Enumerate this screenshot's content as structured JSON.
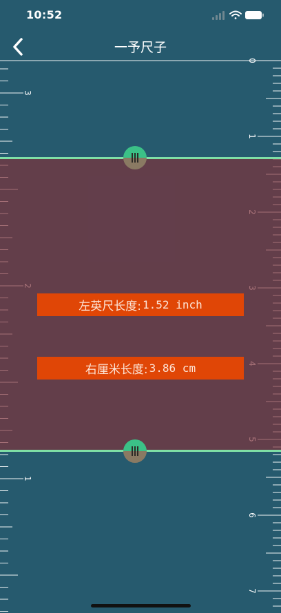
{
  "status_bar": {
    "time": "10:52",
    "icons": [
      "cellular-icon",
      "wifi-icon",
      "battery-icon"
    ]
  },
  "nav": {
    "back_icon": "chevron-left-icon",
    "title": "一予尺子"
  },
  "ruler": {
    "left_labels": [
      "3",
      "2",
      "1"
    ],
    "right_labels": [
      "0",
      "1",
      "2",
      "3",
      "4",
      "5",
      "6",
      "7"
    ]
  },
  "measurement": {
    "left_label": "左英尺长度:",
    "left_value": "1.52 inch",
    "right_label": "右厘米长度:",
    "right_value": "3.86 cm"
  },
  "colors": {
    "background": "#265a6e",
    "selection_overlay": "#80303a",
    "boundary_line": "#7fe0a6",
    "readout_background": "#e04606"
  }
}
